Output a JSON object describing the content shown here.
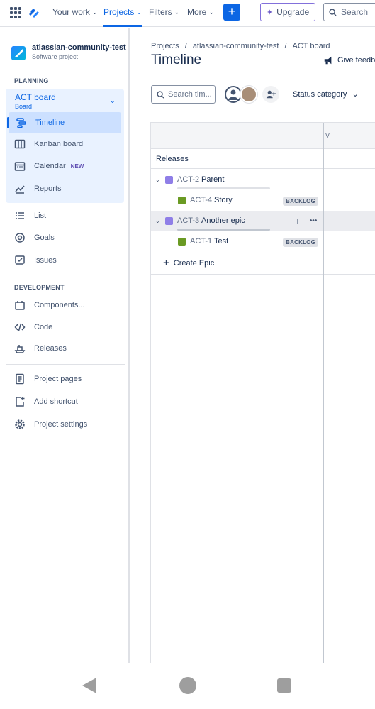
{
  "topnav": {
    "your_work": "Your work",
    "projects": "Projects",
    "filters": "Filters",
    "more": "More",
    "create": "+",
    "upgrade": "Upgrade",
    "search_placeholder": "Search"
  },
  "sidebar": {
    "project_name": "atlassian-community-test",
    "project_type": "Software project",
    "planning_label": "PLANNING",
    "board_title": "ACT board",
    "board_sub": "Board",
    "planning_items": [
      {
        "label": "Timeline",
        "icon": "timeline-icon"
      },
      {
        "label": "Kanban board",
        "icon": "kanban-icon"
      },
      {
        "label": "Calendar",
        "icon": "calendar-icon",
        "badge": "NEW"
      },
      {
        "label": "Reports",
        "icon": "reports-icon"
      }
    ],
    "other_items": [
      {
        "label": "List",
        "icon": "list-icon"
      },
      {
        "label": "Goals",
        "icon": "goals-icon"
      },
      {
        "label": "Issues",
        "icon": "issues-icon"
      }
    ],
    "development_label": "DEVELOPMENT",
    "dev_items": [
      {
        "label": "Components...",
        "icon": "components-icon"
      },
      {
        "label": "Code",
        "icon": "code-icon"
      },
      {
        "label": "Releases",
        "icon": "releases-icon"
      }
    ],
    "bottom_items": [
      {
        "label": "Project pages",
        "icon": "page-icon"
      },
      {
        "label": "Add shortcut",
        "icon": "add-shortcut-icon"
      },
      {
        "label": "Project settings",
        "icon": "gear-icon"
      }
    ]
  },
  "main": {
    "breadcrumb": [
      "Projects",
      "/",
      "atlassian-community-test",
      "/",
      "ACT board"
    ],
    "title": "Timeline",
    "feedback": "Give feedba",
    "search_placeholder": "Search tim...",
    "status_filter": "Status category",
    "month": "V",
    "releases_label": "Releases",
    "rows": [
      {
        "key": "ACT-2",
        "summary": "Parent",
        "type": "epic"
      },
      {
        "key": "ACT-4",
        "summary": "Story",
        "type": "story",
        "status": "BACKLOG"
      },
      {
        "key": "ACT-3",
        "summary": "Another epic",
        "type": "epic"
      },
      {
        "key": "ACT-1",
        "summary": "Test",
        "type": "story",
        "status": "BACKLOG"
      }
    ],
    "row_add": "+",
    "row_more": "•••",
    "create_epic": "Create Epic"
  },
  "colors": {
    "accent": "#0c66e4",
    "epic": "#8f7ee7",
    "story": "#6a9a23"
  }
}
